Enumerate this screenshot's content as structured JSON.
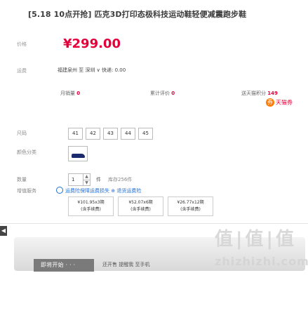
{
  "product": {
    "title": "[5.18 10点开抢] 匹克3D打印态极科技运动鞋轻便减震跑步鞋",
    "price_label": "价格",
    "price": "¥299.00"
  },
  "shipping": {
    "label": "运费",
    "text": "福建泉州 至 深圳 ∨ 快递: 0.00"
  },
  "stats": {
    "monthly_label": "月销量",
    "monthly_value": "0",
    "reviews_label": "累计评价",
    "reviews_value": "0",
    "points_label": "送天猫积分",
    "points_value": "149",
    "coupon_label": "天猫券"
  },
  "sizes": {
    "label": "尺码",
    "options": [
      "41",
      "42",
      "43",
      "44",
      "45"
    ]
  },
  "color": {
    "label": "颜色分类"
  },
  "quantity": {
    "label": "数量",
    "value": "1",
    "unit": "件",
    "stock": "库存256件"
  },
  "service": {
    "label": "增值服务",
    "radio_text": "运费险保障运费损失 ⊕ 退货运费险",
    "options": [
      {
        "price": "¥101.95x3期",
        "note": "(含手续费)"
      },
      {
        "price": "¥52.07x6期",
        "note": "(含手续费)"
      },
      {
        "price": "¥26.77x12期",
        "note": "(含手续费)"
      }
    ]
  },
  "actions": {
    "buy_label": "即将开始 · · ·",
    "remind_text": "还开售 提醒我 至手机"
  },
  "watermark": {
    "top": "值|值|值",
    "bottom": "zhizhizhi.com"
  },
  "colors": {
    "accent": "#e4003a",
    "link": "#1e6fd9",
    "coupon": "#ff7a00"
  },
  "icons": [
    "side-toggle-icon",
    "coupon-icon",
    "shoe-thumbnail-icon"
  ]
}
